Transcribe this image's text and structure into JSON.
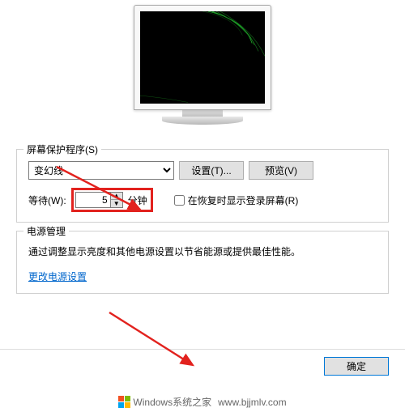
{
  "screensaver": {
    "section_label": "屏幕保护程序(S)",
    "selected": "变幻线",
    "settings_btn": "设置(T)...",
    "preview_btn": "预览(V)",
    "wait_label": "等待(W):",
    "wait_value": "5",
    "wait_unit": "分钟",
    "resume_checkbox_label": "在恢复时显示登录屏幕(R)",
    "resume_checked": false
  },
  "power": {
    "section_label": "电源管理",
    "description": "通过调整显示亮度和其他电源设置以节省能源或提供最佳性能。",
    "link_label": "更改电源设置"
  },
  "buttons": {
    "ok": "确定"
  },
  "watermark": {
    "brand": "Windows系统之家",
    "url": "www.bjjmlv.com"
  }
}
